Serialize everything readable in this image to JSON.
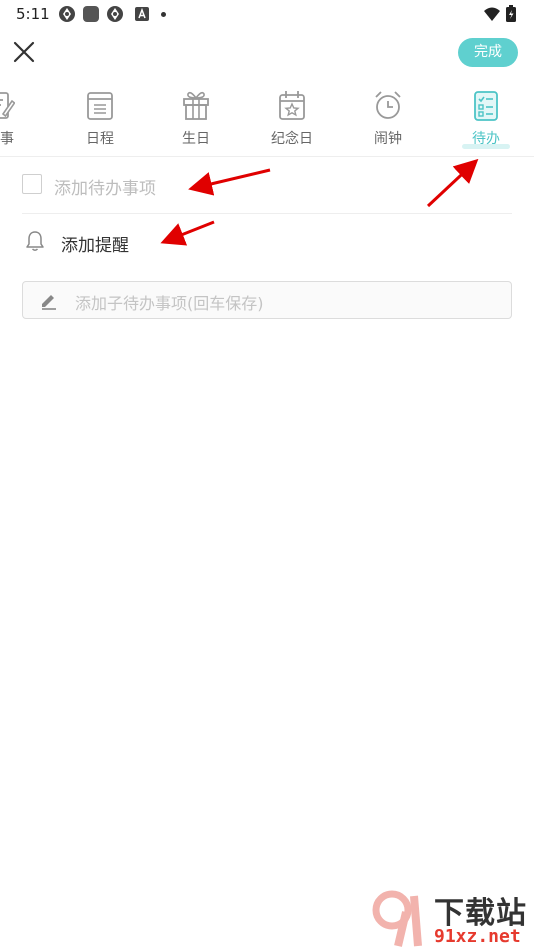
{
  "status_bar": {
    "time": "5:11",
    "icons": [
      "aperture-icon",
      "app-square-icon",
      "aperture-icon",
      "font-a-icon",
      "notification-dot",
      "wifi-icon",
      "battery-charging-icon"
    ]
  },
  "header": {
    "close_icon": "close-icon",
    "done_label": "完成",
    "done_color": "#5fd0cf"
  },
  "tabs": [
    {
      "label": "记事",
      "icon": "note-edit-icon",
      "active": false
    },
    {
      "label": "日程",
      "icon": "calendar-list-icon",
      "active": false
    },
    {
      "label": "生日",
      "icon": "gift-icon",
      "active": false
    },
    {
      "label": "纪念日",
      "icon": "calendar-star-icon",
      "active": false
    },
    {
      "label": "闹钟",
      "icon": "alarm-clock-icon",
      "active": false
    },
    {
      "label": "待办",
      "icon": "checklist-icon",
      "active": true
    }
  ],
  "accent_color": "#4cc4c6",
  "todo": {
    "placeholder": "添加待办事项"
  },
  "reminder": {
    "label": "添加提醒"
  },
  "subtask": {
    "placeholder": "添加子待办事项(回车保存)"
  },
  "watermark": {
    "title": "下载站",
    "domain": "91xz.net"
  }
}
